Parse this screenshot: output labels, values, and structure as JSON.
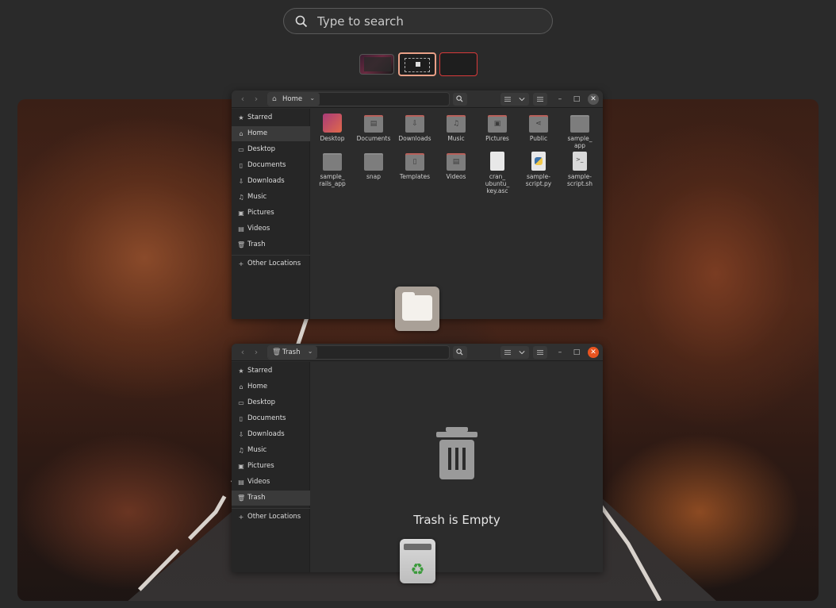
{
  "search": {
    "placeholder": "Type to search"
  },
  "window_home": {
    "location": "Home",
    "sidebar": [
      {
        "label": "Starred",
        "icon": "star-icon"
      },
      {
        "label": "Home",
        "icon": "home-icon"
      },
      {
        "label": "Desktop",
        "icon": "desktop-icon"
      },
      {
        "label": "Documents",
        "icon": "documents-icon"
      },
      {
        "label": "Downloads",
        "icon": "downloads-icon"
      },
      {
        "label": "Music",
        "icon": "music-icon"
      },
      {
        "label": "Pictures",
        "icon": "pictures-icon"
      },
      {
        "label": "Videos",
        "icon": "videos-icon"
      },
      {
        "label": "Trash",
        "icon": "trash-icon"
      },
      {
        "label": "Other Locations",
        "icon": "plus-icon"
      }
    ],
    "files": [
      {
        "name": "Desktop"
      },
      {
        "name": "Documents"
      },
      {
        "name": "Downloads"
      },
      {
        "name": "Music"
      },
      {
        "name": "Pictures"
      },
      {
        "name": "Public"
      },
      {
        "name": "sample_\napp"
      },
      {
        "name": "sample_\nrails_app"
      },
      {
        "name": "snap"
      },
      {
        "name": "Templates"
      },
      {
        "name": "Videos"
      },
      {
        "name": "cran_\nubuntu_\nkey.asc"
      },
      {
        "name": "sample-\nscript.py"
      },
      {
        "name": "sample-\nscript.sh"
      }
    ]
  },
  "window_trash": {
    "location": "Trash",
    "sidebar": [
      {
        "label": "Starred"
      },
      {
        "label": "Home"
      },
      {
        "label": "Desktop"
      },
      {
        "label": "Documents"
      },
      {
        "label": "Downloads"
      },
      {
        "label": "Music"
      },
      {
        "label": "Pictures"
      },
      {
        "label": "Videos"
      },
      {
        "label": "Trash"
      },
      {
        "label": "Other Locations"
      }
    ],
    "empty_message": "Trash is Empty"
  },
  "colors": {
    "accent": "#e95420",
    "workspace_active_border": "#e9a087",
    "workspace_new_border": "#d83a3a"
  }
}
